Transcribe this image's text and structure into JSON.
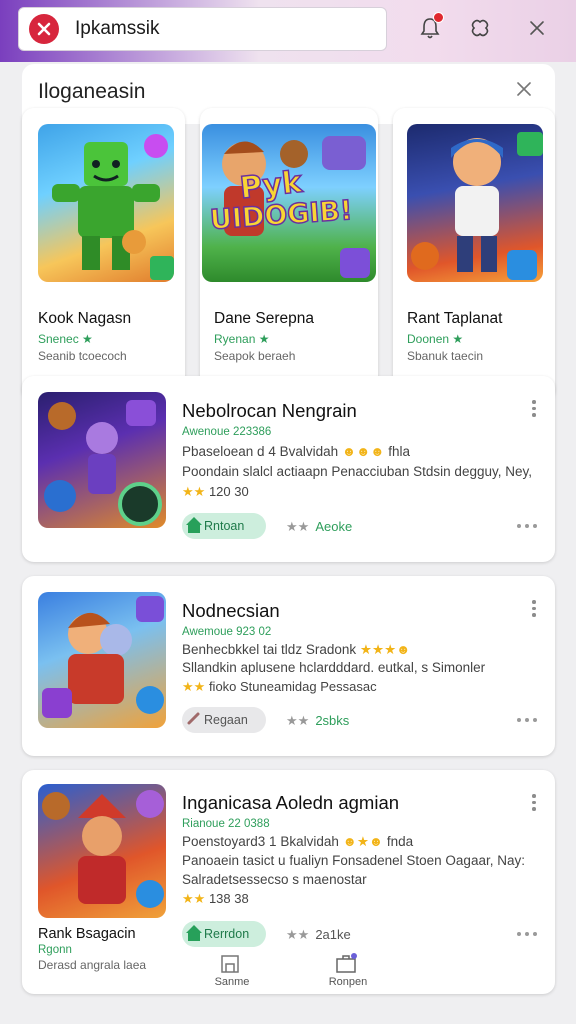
{
  "header": {
    "search_value": "Ipkamssik",
    "search_value_display": "Ipkamssik"
  },
  "featured": {
    "title": "Iloganeasin",
    "tiles": [
      {
        "name": "Kook Nagasn",
        "sub": "Snenec",
        "desc": "Seanib tcoecoch"
      },
      {
        "name": "Dane Serepna",
        "sub": "Ryenan",
        "desc": "Seapok beraeh"
      },
      {
        "name": "Rant Taplanat",
        "sub": "Doonen",
        "desc": "Sbanuk taecin"
      }
    ],
    "banner_text_top": "Pyk",
    "banner_text_bottom": "UIDOGIB!"
  },
  "list": [
    {
      "title": "Nebolrocan Nengrain",
      "meta": "Awenoue 223386",
      "line1": "Pbaseloean d 4 Bvalvidah",
      "line1_tail": "fhla",
      "line2": "Poondain slalcl actiaapn Penacciuban Stdsin degguy, Ney,",
      "rating": "120 30",
      "button": "Rntoan",
      "aux": "Aeoke"
    },
    {
      "title": "Nodnecsian",
      "meta": "Awemoue 923 02",
      "line1": "Benhecbkkel tai tldz Sradonk",
      "line1_tail": "",
      "line2": "Sllandkin aplusene hclardddard. eutkal, s Simonler",
      "rating_text": "fioko Stuneamidag Pessasac",
      "button": "Regaan",
      "aux": "2sbks"
    },
    {
      "title": "Inganicasa Aoledn agmian",
      "meta": "Rianoue 22 0388",
      "line1": "Poenstoyard3 1 Bkalvidah",
      "line1_tail": "fnda",
      "line2": "Panoaein tasict u fualiyn Fonsadenel Stoen Oagaar, Nay:",
      "line3": "Salradetsessecso s maenostar",
      "rating": "138 38",
      "button": "Rerrdon",
      "aux": "2a1ke",
      "left_title": "Rank Bsagacin",
      "left_sub": "Rgonn",
      "left_desc": "Derasd angrala laea"
    }
  ],
  "bottom_nav": [
    {
      "label": "Sanme"
    },
    {
      "label": "Ronpen"
    }
  ],
  "colors": {
    "accent_green": "#2e9e5b",
    "header_purple": "#7a3fbe",
    "badge_red": "#d7263d"
  }
}
